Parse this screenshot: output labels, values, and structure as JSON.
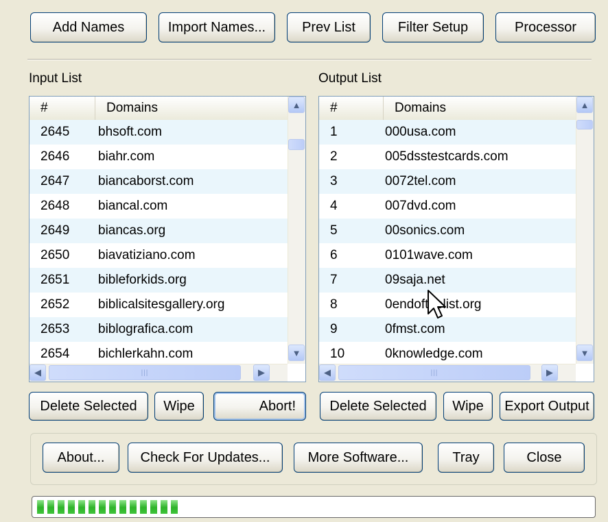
{
  "toolbar": {
    "add_names": "Add Names",
    "import_names": "Import Names...",
    "prev_list": "Prev List",
    "filter_setup": "Filter Setup",
    "processor": "Processor"
  },
  "input_list": {
    "label": "Input List",
    "col_num": "#",
    "col_domains": "Domains",
    "rows": [
      [
        "2645",
        "bhsoft.com"
      ],
      [
        "2646",
        "biahr.com"
      ],
      [
        "2647",
        "biancaborst.com"
      ],
      [
        "2648",
        "biancal.com"
      ],
      [
        "2649",
        "biancas.org"
      ],
      [
        "2650",
        "biavatiziano.com"
      ],
      [
        "2651",
        "bibleforkids.org"
      ],
      [
        "2652",
        "biblicalsitesgallery.org"
      ],
      [
        "2653",
        "biblografica.com"
      ],
      [
        "2654",
        "bichlerkahn.com"
      ]
    ],
    "delete_selected": "Delete Selected",
    "wipe": "Wipe",
    "abort": "Abort!"
  },
  "output_list": {
    "label": "Output List",
    "col_num": "#",
    "col_domains": "Domains",
    "rows": [
      [
        "1",
        "000usa.com"
      ],
      [
        "2",
        "005dsstestcards.com"
      ],
      [
        "3",
        "0072tel.com"
      ],
      [
        "4",
        "007dvd.com"
      ],
      [
        "5",
        "00sonics.com"
      ],
      [
        "6",
        "0101wave.com"
      ],
      [
        "7",
        "09saja.net"
      ],
      [
        "8",
        "0endofthelist.org"
      ],
      [
        "9",
        "0fmst.com"
      ],
      [
        "10",
        "0knowledge.com"
      ]
    ],
    "delete_selected": "Delete Selected",
    "wipe": "Wipe",
    "export_output": "Export Output"
  },
  "bottom": {
    "about": "About...",
    "check_updates": "Check For Updates...",
    "more_software": "More Software...",
    "tray": "Tray",
    "close": "Close"
  },
  "progress": {
    "filled_segments": 14,
    "fraction": 0.21
  },
  "colors": {
    "row_alt": "#eaf6fc",
    "progress": "#2fb32a",
    "window_bg": "#ece9d8"
  },
  "icons": [
    "scroll-up-icon",
    "scroll-down-icon",
    "scroll-left-icon",
    "scroll-right-icon",
    "mouse-cursor-icon"
  ]
}
